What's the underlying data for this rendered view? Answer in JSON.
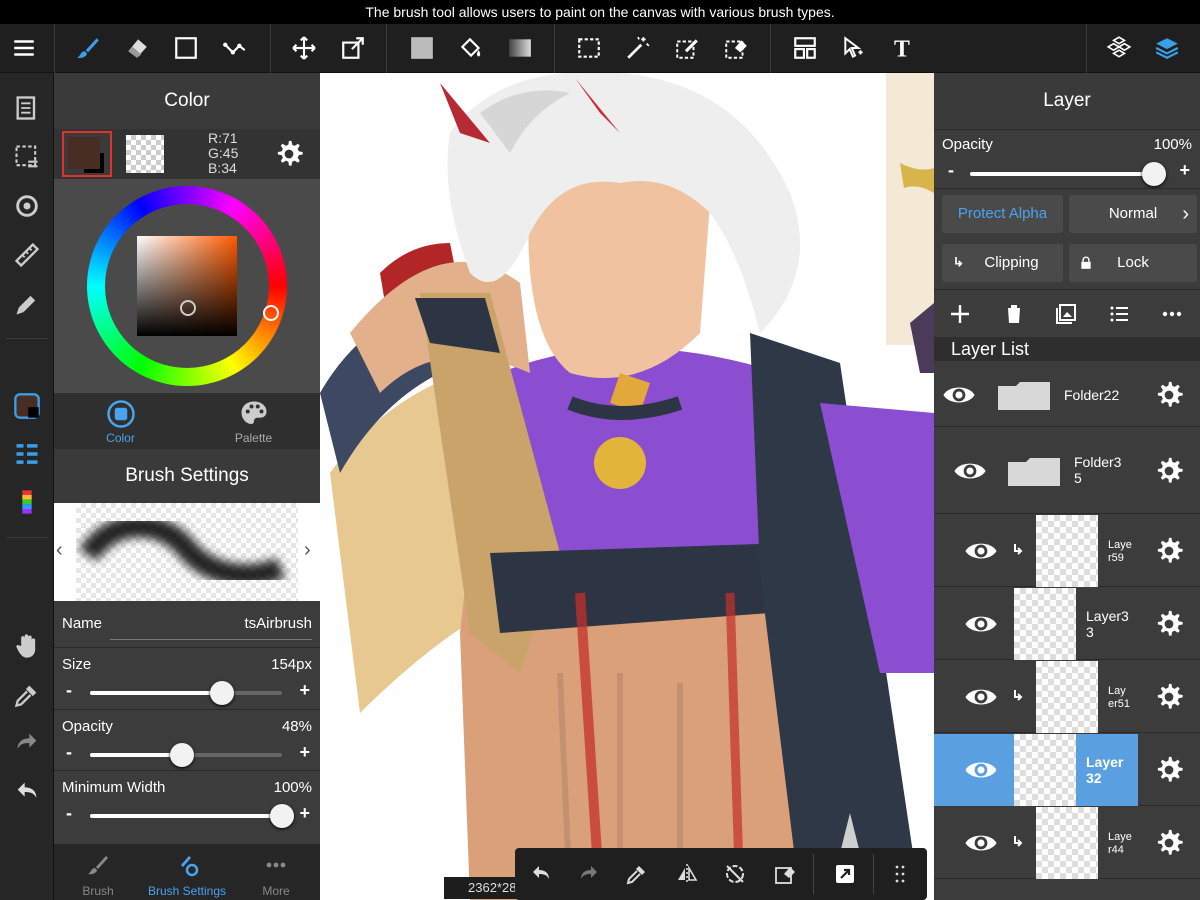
{
  "tooltip": "The brush tool allows users to paint on the canvas with various brush types.",
  "colors": {
    "primary": "#472D22",
    "accent": "#5aa0e0",
    "toolbar": "#1f1f1f",
    "panel": "#3c3c3c"
  },
  "toolbar": {
    "icons": [
      "menu-icon",
      "brush-icon",
      "eraser-icon",
      "rectangle-icon",
      "polyline-icon",
      "move-icon",
      "transform-icon",
      "fill-color-icon",
      "bucket-icon",
      "gradient-icon",
      "select-rect-icon",
      "magic-wand-icon",
      "select-pen-icon",
      "select-eraser-icon",
      "layout-icon",
      "select-arrow-icon",
      "text-icon",
      "materials-icon",
      "layers-icon"
    ]
  },
  "color_panel": {
    "title": "Color",
    "rgb": {
      "r": "R:71",
      "g": "G:45",
      "b": "B:34"
    },
    "tabs": [
      {
        "label": "Color"
      },
      {
        "label": "Palette"
      }
    ]
  },
  "brush_panel": {
    "title": "Brush Settings",
    "name_label": "Name",
    "name_value": "tsAirbrush",
    "size_label": "Size",
    "size_value": "154px",
    "size_fraction": 0.69,
    "opacity_label": "Opacity",
    "opacity_value": "48%",
    "opacity_fraction": 0.48,
    "minwidth_label": "Minimum Width",
    "minwidth_value": "100%",
    "minwidth_fraction": 1.0,
    "minus": "-",
    "plus": "+",
    "tabs": [
      {
        "label": "Brush"
      },
      {
        "label": "Brush Settings"
      },
      {
        "label": "More"
      }
    ]
  },
  "canvas": {
    "size_label": "2362*28"
  },
  "layer_panel": {
    "title": "Layer",
    "opacity_label": "Opacity",
    "opacity_value": "100%",
    "opacity_fraction": 1.0,
    "minus": "-",
    "plus": "+",
    "protect_alpha": "Protect Alpha",
    "blend_mode": "Normal",
    "clipping": "Clipping",
    "lock": "Lock",
    "list_title": "Layer List",
    "layers": [
      {
        "name": "Folder22"
      },
      {
        "name": "Folder3\n5"
      },
      {
        "name": "Laye\nr59"
      },
      {
        "name": "Layer3\n3"
      },
      {
        "name": "Lay\ner51"
      },
      {
        "name": "Layer\n32"
      },
      {
        "name": "Laye\nr44"
      }
    ]
  }
}
